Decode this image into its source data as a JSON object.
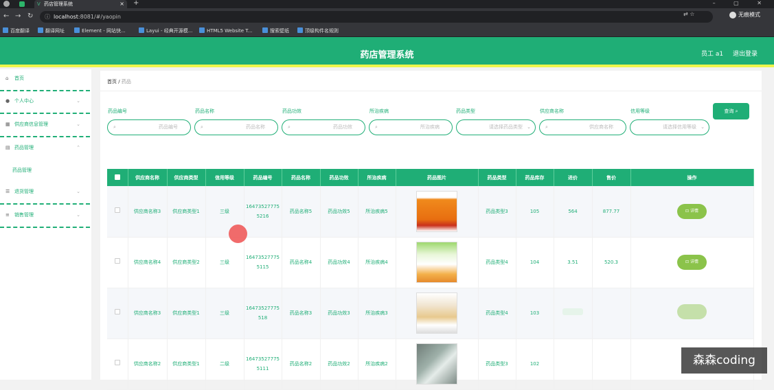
{
  "browser": {
    "tab_title": "药店管理系统",
    "url_host": "localhost",
    "url_rest": ":8081/#/yaopin",
    "profile_label": "无痕模式",
    "window_controls": "– ▢ ✕",
    "bookmarks": [
      "百度翻译",
      "翻译网址",
      "Element - 网站快...",
      "Layui - 经典开源模...",
      "HTML5 Website T...",
      "搜索壁纸",
      "顶级构件名规则"
    ]
  },
  "header": {
    "title": "药店管理系统",
    "user": "员工 a1",
    "logout": "退出登录"
  },
  "sidebar": {
    "items": [
      {
        "label": "首页",
        "icon": "home-icon"
      },
      {
        "label": "个人中心",
        "icon": "user-icon"
      },
      {
        "label": "供应商信息管理",
        "icon": "menu-icon"
      },
      {
        "label": "药品管理",
        "icon": "menu-icon"
      },
      {
        "label": "退货管理",
        "icon": "list-icon"
      },
      {
        "label": "销售管理",
        "icon": "sliders-icon"
      }
    ],
    "sub_item": "药品管理"
  },
  "breadcrumb": {
    "home": "首页",
    "sep": "/",
    "current": "药品"
  },
  "filters": [
    {
      "label": "药品编号",
      "placeholder": "药品编号"
    },
    {
      "label": "药品名称",
      "placeholder": "药品名称"
    },
    {
      "label": "药品功效",
      "placeholder": "药品功效"
    },
    {
      "label": "所治疾病",
      "placeholder": "所治疾病"
    },
    {
      "label": "药品类型",
      "placeholder": "请选择药品类型"
    },
    {
      "label": "供应商名称",
      "placeholder": "供应商名称"
    },
    {
      "label": "信用等级",
      "placeholder": "请选择信用等级"
    }
  ],
  "query_button": "查询",
  "table": {
    "headers": [
      "供应商名称",
      "供应商类型",
      "信用等级",
      "药品编号",
      "药品名称",
      "药品功效",
      "所治疾病",
      "药品图片",
      "药品类型",
      "药品库存",
      "进价",
      "售价",
      "操作"
    ],
    "detail_label": "详情",
    "rows": [
      {
        "supplier": "供应商名称3",
        "stype": "供应商类型1",
        "credit": "三级",
        "code": "164735277755216",
        "name": "药品名称5",
        "effect": "药品功效5",
        "disease": "所治疾病5",
        "img": "orange-bottle",
        "dtype": "药品类型3",
        "stock": "105",
        "cost": "564",
        "price": "877.77",
        "show_btn": true
      },
      {
        "supplier": "供应商名称4",
        "stype": "供应商类型2",
        "credit": "三级",
        "code": "164735277755115",
        "name": "药品名称4",
        "effect": "药品功效4",
        "disease": "所治疾病4",
        "img": "green-box",
        "dtype": "药品类型4",
        "stock": "104",
        "cost": "3.51",
        "price": "520.3",
        "show_btn": true
      },
      {
        "supplier": "供应商名称3",
        "stype": "供应商类型1",
        "credit": "三级",
        "code": "16473527775518",
        "name": "药品名称3",
        "effect": "药品功效3",
        "disease": "所治疾病3",
        "img": "beige-box",
        "dtype": "药品类型4",
        "stock": "103",
        "cost": "",
        "price": "",
        "show_btn": false
      },
      {
        "supplier": "供应商名称2",
        "stype": "供应商类型1",
        "credit": "二级",
        "code": "164735277755111",
        "name": "药品名称2",
        "effect": "药品功效2",
        "disease": "所治疾病2",
        "img": "grey-pack",
        "dtype": "药品类型3",
        "stock": "102",
        "cost": "",
        "price": "",
        "show_btn": false
      }
    ]
  },
  "watermark": "森森coding"
}
